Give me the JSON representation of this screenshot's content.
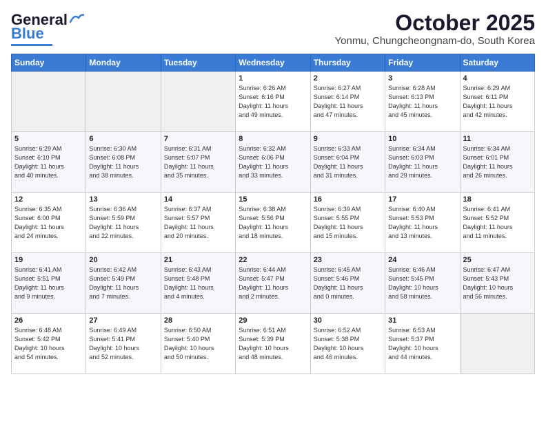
{
  "header": {
    "logo_general": "General",
    "logo_blue": "Blue",
    "month": "October 2025",
    "location": "Yonmu, Chungcheongnam-do, South Korea"
  },
  "weekdays": [
    "Sunday",
    "Monday",
    "Tuesday",
    "Wednesday",
    "Thursday",
    "Friday",
    "Saturday"
  ],
  "weeks": [
    [
      {
        "day": "",
        "text": ""
      },
      {
        "day": "",
        "text": ""
      },
      {
        "day": "",
        "text": ""
      },
      {
        "day": "1",
        "text": "Sunrise: 6:26 AM\nSunset: 6:16 PM\nDaylight: 11 hours\nand 49 minutes."
      },
      {
        "day": "2",
        "text": "Sunrise: 6:27 AM\nSunset: 6:14 PM\nDaylight: 11 hours\nand 47 minutes."
      },
      {
        "day": "3",
        "text": "Sunrise: 6:28 AM\nSunset: 6:13 PM\nDaylight: 11 hours\nand 45 minutes."
      },
      {
        "day": "4",
        "text": "Sunrise: 6:29 AM\nSunset: 6:11 PM\nDaylight: 11 hours\nand 42 minutes."
      }
    ],
    [
      {
        "day": "5",
        "text": "Sunrise: 6:29 AM\nSunset: 6:10 PM\nDaylight: 11 hours\nand 40 minutes."
      },
      {
        "day": "6",
        "text": "Sunrise: 6:30 AM\nSunset: 6:08 PM\nDaylight: 11 hours\nand 38 minutes."
      },
      {
        "day": "7",
        "text": "Sunrise: 6:31 AM\nSunset: 6:07 PM\nDaylight: 11 hours\nand 35 minutes."
      },
      {
        "day": "8",
        "text": "Sunrise: 6:32 AM\nSunset: 6:06 PM\nDaylight: 11 hours\nand 33 minutes."
      },
      {
        "day": "9",
        "text": "Sunrise: 6:33 AM\nSunset: 6:04 PM\nDaylight: 11 hours\nand 31 minutes."
      },
      {
        "day": "10",
        "text": "Sunrise: 6:34 AM\nSunset: 6:03 PM\nDaylight: 11 hours\nand 29 minutes."
      },
      {
        "day": "11",
        "text": "Sunrise: 6:34 AM\nSunset: 6:01 PM\nDaylight: 11 hours\nand 26 minutes."
      }
    ],
    [
      {
        "day": "12",
        "text": "Sunrise: 6:35 AM\nSunset: 6:00 PM\nDaylight: 11 hours\nand 24 minutes."
      },
      {
        "day": "13",
        "text": "Sunrise: 6:36 AM\nSunset: 5:59 PM\nDaylight: 11 hours\nand 22 minutes."
      },
      {
        "day": "14",
        "text": "Sunrise: 6:37 AM\nSunset: 5:57 PM\nDaylight: 11 hours\nand 20 minutes."
      },
      {
        "day": "15",
        "text": "Sunrise: 6:38 AM\nSunset: 5:56 PM\nDaylight: 11 hours\nand 18 minutes."
      },
      {
        "day": "16",
        "text": "Sunrise: 6:39 AM\nSunset: 5:55 PM\nDaylight: 11 hours\nand 15 minutes."
      },
      {
        "day": "17",
        "text": "Sunrise: 6:40 AM\nSunset: 5:53 PM\nDaylight: 11 hours\nand 13 minutes."
      },
      {
        "day": "18",
        "text": "Sunrise: 6:41 AM\nSunset: 5:52 PM\nDaylight: 11 hours\nand 11 minutes."
      }
    ],
    [
      {
        "day": "19",
        "text": "Sunrise: 6:41 AM\nSunset: 5:51 PM\nDaylight: 11 hours\nand 9 minutes."
      },
      {
        "day": "20",
        "text": "Sunrise: 6:42 AM\nSunset: 5:49 PM\nDaylight: 11 hours\nand 7 minutes."
      },
      {
        "day": "21",
        "text": "Sunrise: 6:43 AM\nSunset: 5:48 PM\nDaylight: 11 hours\nand 4 minutes."
      },
      {
        "day": "22",
        "text": "Sunrise: 6:44 AM\nSunset: 5:47 PM\nDaylight: 11 hours\nand 2 minutes."
      },
      {
        "day": "23",
        "text": "Sunrise: 6:45 AM\nSunset: 5:46 PM\nDaylight: 11 hours\nand 0 minutes."
      },
      {
        "day": "24",
        "text": "Sunrise: 6:46 AM\nSunset: 5:45 PM\nDaylight: 10 hours\nand 58 minutes."
      },
      {
        "day": "25",
        "text": "Sunrise: 6:47 AM\nSunset: 5:43 PM\nDaylight: 10 hours\nand 56 minutes."
      }
    ],
    [
      {
        "day": "26",
        "text": "Sunrise: 6:48 AM\nSunset: 5:42 PM\nDaylight: 10 hours\nand 54 minutes."
      },
      {
        "day": "27",
        "text": "Sunrise: 6:49 AM\nSunset: 5:41 PM\nDaylight: 10 hours\nand 52 minutes."
      },
      {
        "day": "28",
        "text": "Sunrise: 6:50 AM\nSunset: 5:40 PM\nDaylight: 10 hours\nand 50 minutes."
      },
      {
        "day": "29",
        "text": "Sunrise: 6:51 AM\nSunset: 5:39 PM\nDaylight: 10 hours\nand 48 minutes."
      },
      {
        "day": "30",
        "text": "Sunrise: 6:52 AM\nSunset: 5:38 PM\nDaylight: 10 hours\nand 46 minutes."
      },
      {
        "day": "31",
        "text": "Sunrise: 6:53 AM\nSunset: 5:37 PM\nDaylight: 10 hours\nand 44 minutes."
      },
      {
        "day": "",
        "text": ""
      }
    ]
  ]
}
